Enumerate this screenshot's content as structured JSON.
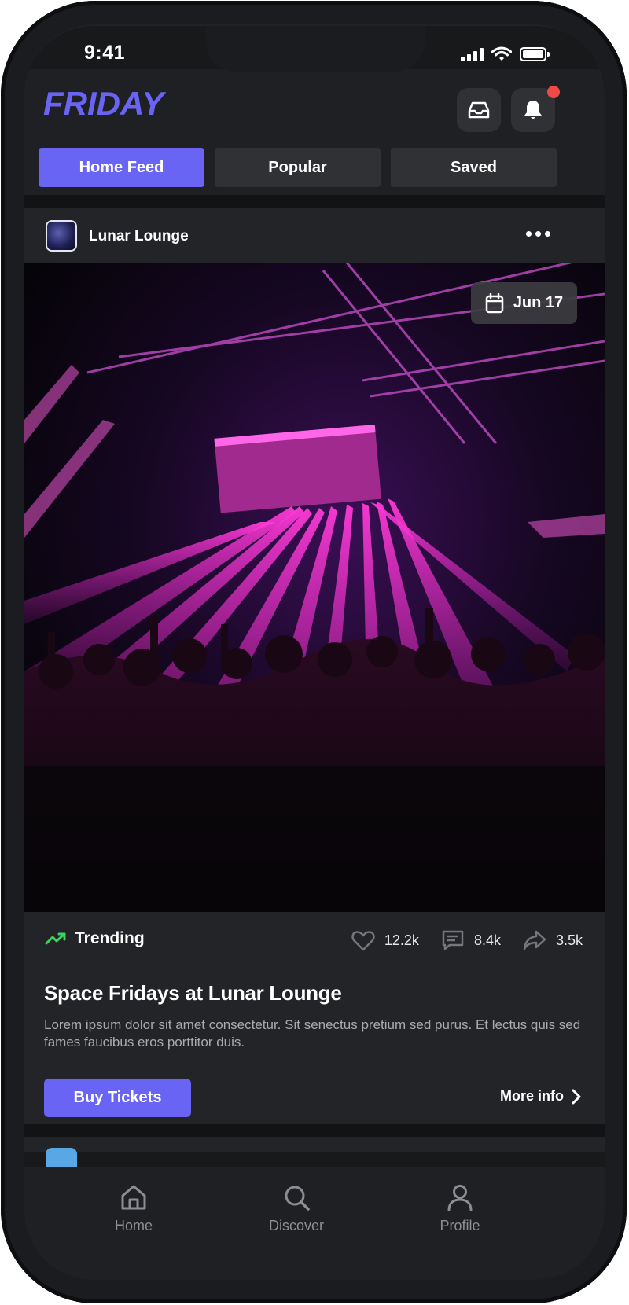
{
  "status_bar": {
    "time": "9:41"
  },
  "app": {
    "logo": "FRIDAY",
    "accent_color": "#6a64f5",
    "header_icons": [
      "inbox-icon",
      "bell-icon"
    ]
  },
  "tabs": [
    {
      "label": "Home Feed",
      "active": true
    },
    {
      "label": "Popular",
      "active": false
    },
    {
      "label": "Saved",
      "active": false
    }
  ],
  "post": {
    "author": "Lunar Lounge",
    "date": "Jun 17",
    "badge": "Trending",
    "stats": {
      "likes": "12.2k",
      "comments": "8.4k",
      "shares": "3.5k"
    },
    "title": "Space Fridays at Lunar Lounge",
    "description": "Lorem ipsum dolor sit amet consectetur. Sit senectus pretium sed purus. Et lectus quis sed fames faucibus eros porttitor duis.",
    "primary_action": "Buy Tickets",
    "secondary_action": "More info"
  },
  "bottom_nav": [
    {
      "label": "Home",
      "icon": "home-icon"
    },
    {
      "label": "Discover",
      "icon": "search-icon"
    },
    {
      "label": "Profile",
      "icon": "user-icon"
    }
  ]
}
